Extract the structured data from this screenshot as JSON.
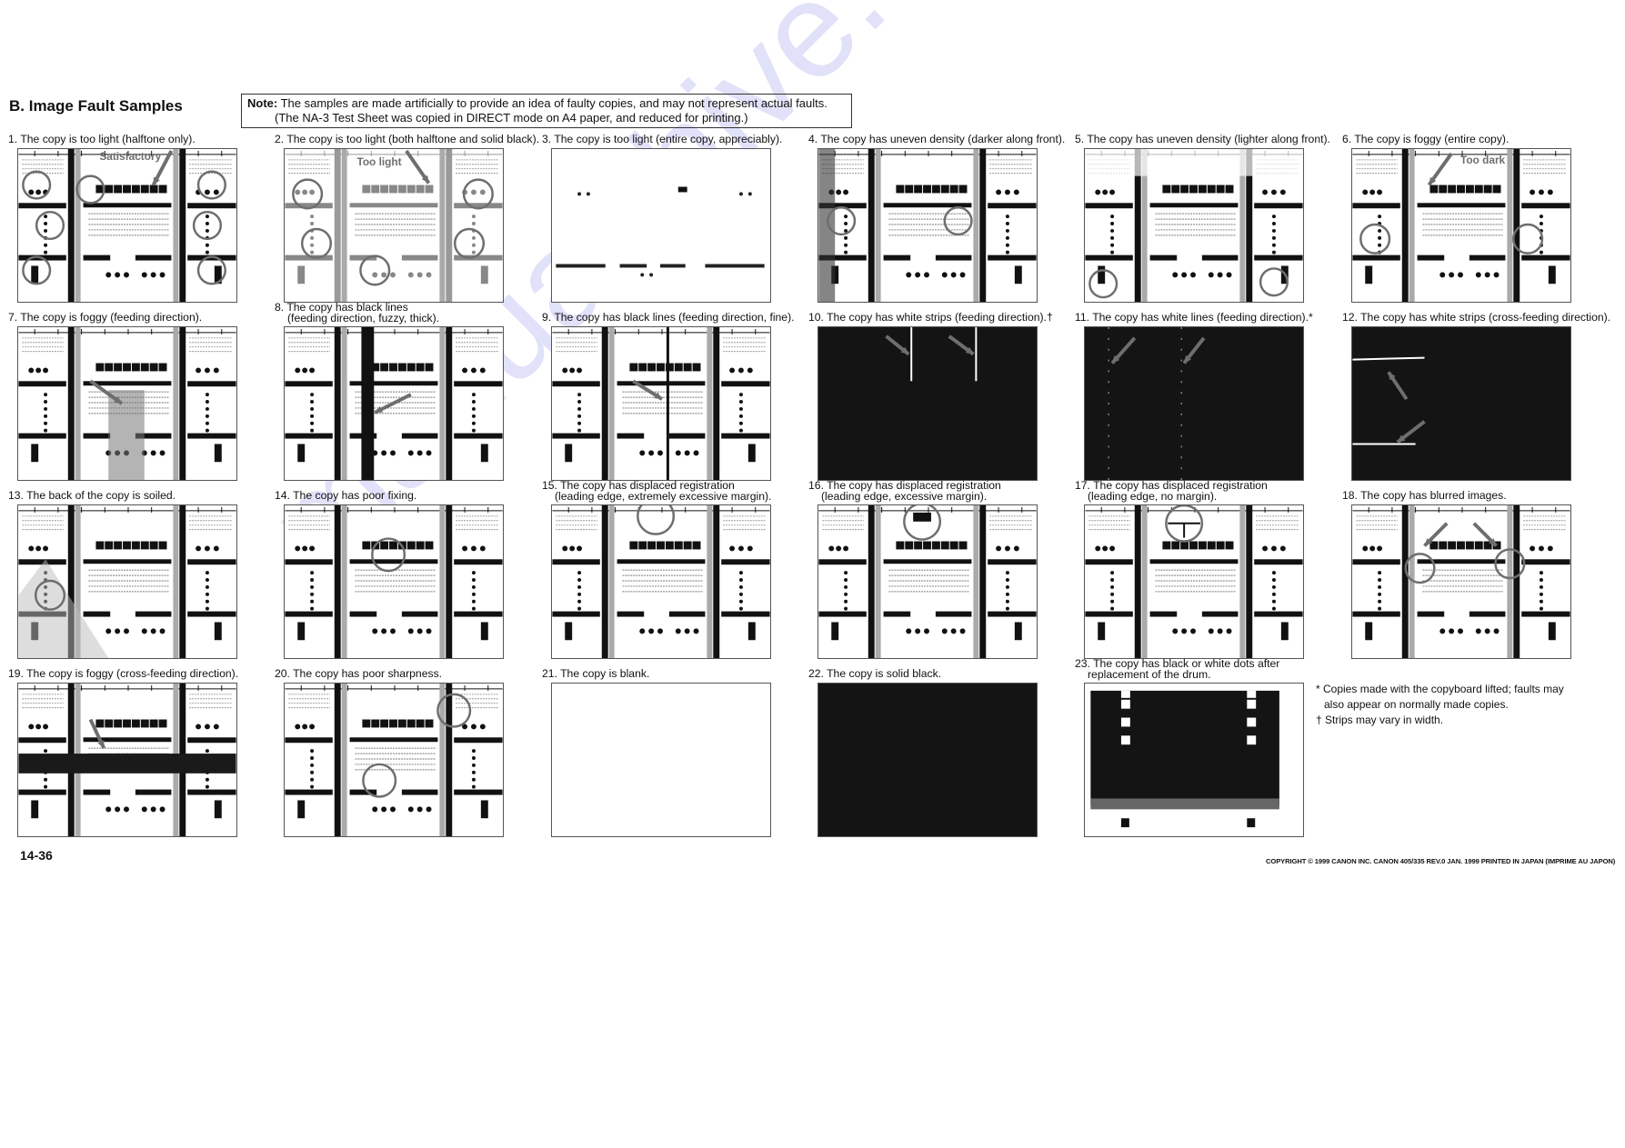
{
  "section_title": "B.  Image Fault Samples",
  "note": {
    "label": "Note:",
    "line1": " The samples are made artificially to provide an idea of faulty copies, and may not represent actual faults.",
    "line2": "(The NA-3 Test Sheet was copied in DIRECT mode on A4 paper, and reduced for printing.)"
  },
  "samples": [
    {
      "caption": "1. The copy is too light (halftone only).",
      "caption2": "",
      "variant": "light-halftone",
      "annotation": "Satisfactory"
    },
    {
      "caption": "2. The copy is too light (both halftone and solid black).",
      "caption2": "",
      "variant": "light-both",
      "annotation": "Too light"
    },
    {
      "caption": "3. The copy is too light (entire copy, appreciably).",
      "caption2": "",
      "variant": "very-light",
      "annotation": ""
    },
    {
      "caption": "4. The copy has uneven density (darker along front).",
      "caption2": "",
      "variant": "uneven-dark",
      "annotation": ""
    },
    {
      "caption": "5. The copy has uneven density (lighter along front).",
      "caption2": "",
      "variant": "uneven-light",
      "annotation": ""
    },
    {
      "caption": "6. The copy is foggy (entire copy).",
      "caption2": "",
      "variant": "foggy",
      "annotation": "Too dark"
    },
    {
      "caption": "7. The copy is foggy (feeding direction).",
      "caption2": "",
      "variant": "foggy-feed",
      "annotation": ""
    },
    {
      "caption": "8. The copy has black lines",
      "caption2": "(feeding direction, fuzzy, thick).",
      "variant": "black-thick",
      "annotation": ""
    },
    {
      "caption": "9. The copy has black lines (feeding direction, fine).",
      "caption2": "",
      "variant": "black-fine",
      "annotation": ""
    },
    {
      "caption": "10. The copy has white strips (feeding direction).†",
      "caption2": "",
      "variant": "white-strips",
      "annotation": ""
    },
    {
      "caption": "11. The copy has white lines (feeding direction).*",
      "caption2": "",
      "variant": "white-lines",
      "annotation": ""
    },
    {
      "caption": "12. The copy has white strips (cross-feeding direction).",
      "caption2": "",
      "variant": "white-cross",
      "annotation": ""
    },
    {
      "caption": "13. The back of the copy is soiled.",
      "caption2": "",
      "variant": "soiled",
      "annotation": ""
    },
    {
      "caption": "14. The copy has poor fixing.",
      "caption2": "",
      "variant": "poor-fixing",
      "annotation": ""
    },
    {
      "caption": "15. The copy has displaced registration",
      "caption2": "(leading edge, extremely excessive margin).",
      "variant": "reg-extreme",
      "annotation": ""
    },
    {
      "caption": "16. The copy has displaced registration",
      "caption2": "(leading edge, excessive margin).",
      "variant": "reg-excess",
      "annotation": ""
    },
    {
      "caption": "17. The copy has displaced registration",
      "caption2": "(leading edge, no margin).",
      "variant": "reg-none",
      "annotation": ""
    },
    {
      "caption": "18. The copy has blurred images.",
      "caption2": "",
      "variant": "blurred",
      "annotation": ""
    },
    {
      "caption": "19. The copy is foggy (cross-feeding direction).",
      "caption2": "",
      "variant": "foggy-cross",
      "annotation": ""
    },
    {
      "caption": "20. The copy has poor sharpness.",
      "caption2": "",
      "variant": "poor-sharp",
      "annotation": ""
    },
    {
      "caption": "21. The copy is blank.",
      "caption2": "",
      "variant": "blank",
      "annotation": ""
    },
    {
      "caption": "22. The copy is solid black.",
      "caption2": "",
      "variant": "solid-black",
      "annotation": ""
    },
    {
      "caption": "23. The copy has black or white dots after",
      "caption2": "replacement of the drum.",
      "variant": "drum-dots",
      "annotation": ""
    }
  ],
  "footnotes": {
    "asterisk_line1": "* Copies made with the copyboard lifted; faults may",
    "asterisk_line2": "also appear on normally made copies.",
    "dagger": "† Strips may vary in width."
  },
  "page_number": "14-36",
  "copyright": "COPYRIGHT © 1999 CANON INC.    CANON 405/335 REV.0 JAN. 1999 PRINTED IN JAPAN (IMPRIME AU JAPON)",
  "watermark": "manualshive.com",
  "colors": {
    "ink": "#111111",
    "annotation_gray": "#6e6e6e",
    "watermark": "#c9c9f5"
  }
}
